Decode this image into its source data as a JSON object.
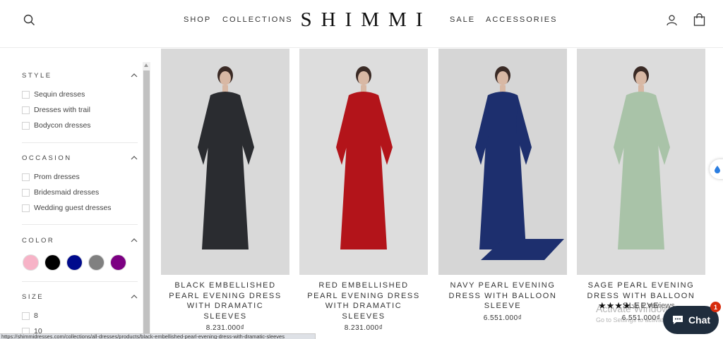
{
  "header": {
    "logo": "SHIMMI",
    "nav_left": [
      "SHOP",
      "COLLECTIONS"
    ],
    "nav_right": [
      "SALE",
      "ACCESSORIES"
    ],
    "icons": [
      "search-icon",
      "account-icon",
      "cart-icon"
    ]
  },
  "filters": {
    "style": {
      "title": "STYLE",
      "options": [
        "Sequin dresses",
        "Dresses with trail",
        "Bodycon dresses"
      ]
    },
    "occasion": {
      "title": "OCCASION",
      "options": [
        "Prom dresses",
        "Bridesmaid dresses",
        "Wedding guest dresses"
      ]
    },
    "color": {
      "title": "COLOR",
      "swatches": [
        "#f7b3c7",
        "#000000",
        "#000a8c",
        "#808080",
        "#7c0082"
      ]
    },
    "size": {
      "title": "SIZE",
      "options": [
        "8",
        "10"
      ]
    }
  },
  "products": [
    {
      "name": "BLACK EMBELLISHED PEARL EVENING DRESS WITH DRAMATIC SLEEVES",
      "price": "8.231.000₫",
      "bg": "#d9d9d9",
      "dress": "#2a2c30"
    },
    {
      "name": "RED EMBELLISHED PEARL EVENING DRESS WITH DRAMATIC SLEEVES",
      "price": "8.231.000₫",
      "bg": "#dddddd",
      "dress": "#b3141a"
    },
    {
      "name": "NAVY PEARL EVENING DRESS WITH BALLOON SLEEVE",
      "price": "6.551.000₫",
      "bg": "#d6d6d6",
      "dress": "#1d2f6e"
    },
    {
      "name": "SAGE PEARL EVENING DRESS WITH BALLOON SLEEVE",
      "price": "6.551.000₫",
      "bg": "#dcdcdc",
      "dress": "#a9c3a8"
    }
  ],
  "rating": {
    "stars": "★★★★☆",
    "text": "2 reviews"
  },
  "overlay": {
    "activate_title": "Activate Windows",
    "activate_sub": "Go to Settings to activate Windows.",
    "chat_label": "Chat",
    "chat_badge": "1"
  },
  "status_url": "https://shimmidresses.com/collections/all-dresses/products/black-embellished-pearl-evening-dress-with-dramatic-sleeves"
}
